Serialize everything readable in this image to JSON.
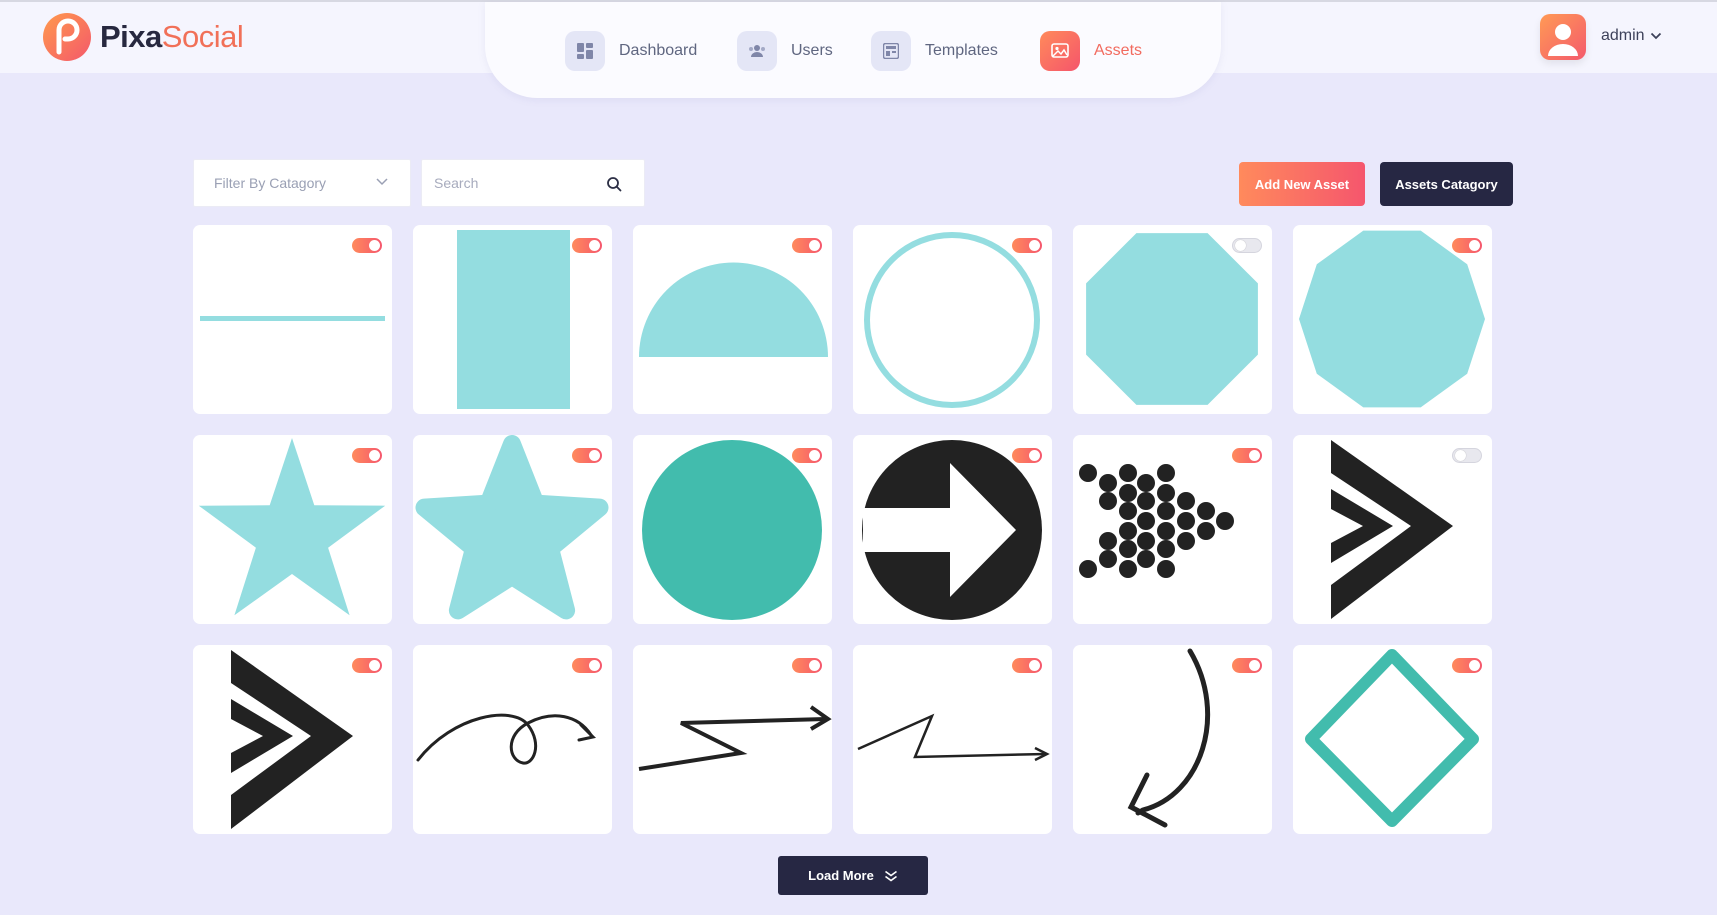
{
  "brand": {
    "name_part1": "Pixa",
    "name_part2": "Social"
  },
  "nav": {
    "items": [
      {
        "label": "Dashboard",
        "icon": "dashboard-icon",
        "active": false
      },
      {
        "label": "Users",
        "icon": "users-icon",
        "active": false
      },
      {
        "label": "Templates",
        "icon": "templates-icon",
        "active": false
      },
      {
        "label": "Assets",
        "icon": "assets-icon",
        "active": true
      }
    ]
  },
  "user": {
    "name": "admin"
  },
  "toolbar": {
    "filter_placeholder": "Filter By Catagory",
    "search_placeholder": "Search",
    "add_label": "Add New Asset",
    "category_label": "Assets Catagory"
  },
  "assets": [
    {
      "shape": "line",
      "enabled": true
    },
    {
      "shape": "rectangle",
      "enabled": true
    },
    {
      "shape": "half-circle",
      "enabled": true
    },
    {
      "shape": "circle-outline",
      "enabled": true
    },
    {
      "shape": "octagon",
      "enabled": false
    },
    {
      "shape": "decagon",
      "enabled": true
    },
    {
      "shape": "star",
      "enabled": true
    },
    {
      "shape": "rounded-star",
      "enabled": true
    },
    {
      "shape": "circle-filled",
      "enabled": true
    },
    {
      "shape": "arrow-circle",
      "enabled": true
    },
    {
      "shape": "dots-arrow",
      "enabled": true
    },
    {
      "shape": "chevron-double",
      "enabled": false
    },
    {
      "shape": "chevron-double",
      "enabled": true
    },
    {
      "shape": "curly-arrow",
      "enabled": true
    },
    {
      "shape": "zigzag-arrow",
      "enabled": true
    },
    {
      "shape": "zigzag-arrow-thin",
      "enabled": true
    },
    {
      "shape": "curved-down-arrow",
      "enabled": true
    },
    {
      "shape": "diamond-outline",
      "enabled": true
    }
  ],
  "pagination": {
    "load_more_label": "Load More"
  },
  "colors": {
    "accent": "#f5566d",
    "accent_start": "#ff8a5c",
    "dark": "#262743",
    "teal": "#94dde0",
    "teal_dark": "#42bcad"
  }
}
